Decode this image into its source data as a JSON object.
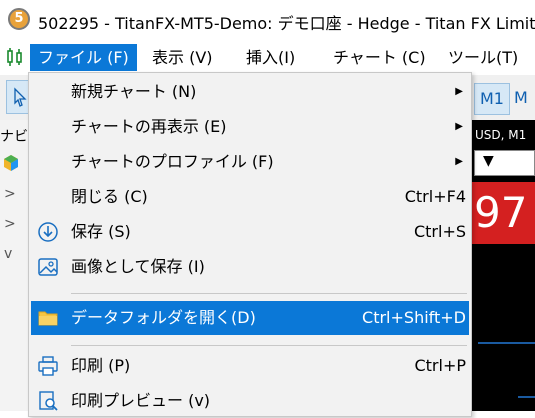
{
  "window": {
    "title": "502295 - TitanFX-MT5-Demo: デモ口座 - Hedge - Titan FX Limit",
    "app_icon_glyph": "5"
  },
  "menubar": {
    "items": [
      {
        "label": "ファイル (F)",
        "active": true
      },
      {
        "label": "表示 (V)",
        "active": false
      },
      {
        "label": "挿入(I)",
        "active": false
      },
      {
        "label": "チャート (C)",
        "active": false
      },
      {
        "label": "ツール(T)",
        "active": false
      }
    ]
  },
  "toolbar": {
    "timeframe_active": "M1",
    "timeframe_next": "M"
  },
  "navigator": {
    "label": "ナビ",
    "expanders": [
      ">",
      ">",
      "v"
    ]
  },
  "chart": {
    "symbol": "USD, M1",
    "dropdown_arrow": "▼",
    "price_fragment": "97",
    "price_box_color": "#d42020"
  },
  "file_menu": {
    "items": [
      {
        "label": "新規チャート (N)",
        "shortcut": "",
        "submenu": true,
        "icon": ""
      },
      {
        "label": "チャートの再表示 (E)",
        "shortcut": "",
        "submenu": true,
        "icon": ""
      },
      {
        "label": "チャートのプロファイル (F)",
        "shortcut": "",
        "submenu": true,
        "icon": ""
      },
      {
        "label": "閉じる (C)",
        "shortcut": "Ctrl+F4",
        "submenu": false,
        "icon": ""
      },
      {
        "label": "保存 (S)",
        "shortcut": "Ctrl+S",
        "submenu": false,
        "icon": "save-icon"
      },
      {
        "label": "画像として保存 (I)",
        "shortcut": "",
        "submenu": false,
        "icon": "image-icon"
      },
      {
        "label": "データフォルダを開く(D)",
        "shortcut": "Ctrl+Shift+D",
        "submenu": false,
        "icon": "folder-icon",
        "highlighted": true
      },
      {
        "label": "印刷 (P)",
        "shortcut": "Ctrl+P",
        "submenu": false,
        "icon": "printer-icon"
      },
      {
        "label": "印刷プレビュー (v)",
        "shortcut": "",
        "submenu": false,
        "icon": "print-preview-icon"
      }
    ]
  },
  "colors": {
    "accent": "#0b78d7",
    "menu_bg": "#f2f2f2"
  }
}
